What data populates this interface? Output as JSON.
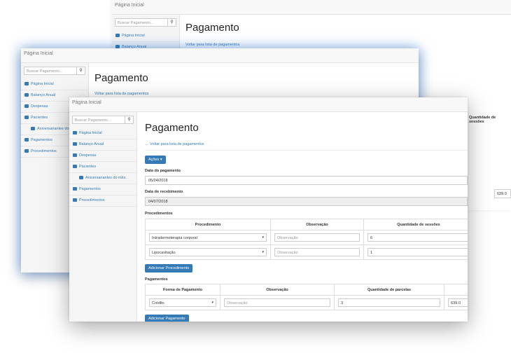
{
  "brand": "Página Inicial",
  "search": {
    "placeholder": "Buscar Pagamento...",
    "icon": "search-icon"
  },
  "sidebar": {
    "items": [
      {
        "label": "Página Inicial",
        "icon": "home-icon"
      },
      {
        "label": "Balanço Anual",
        "icon": "list-icon"
      },
      {
        "label": "Despesas",
        "icon": "list-icon"
      },
      {
        "label": "Pacientes",
        "icon": "list-icon"
      },
      {
        "label": "Aniversariantes do mês",
        "icon": "calendar-icon"
      },
      {
        "label": "Pagamentos",
        "icon": "list-icon"
      },
      {
        "label": "Procedimentos",
        "icon": "list-icon"
      }
    ]
  },
  "page": {
    "title": "Pagamento",
    "back_link": "Voltar para lista de pagamentos",
    "actions_label": "Ações ▾"
  },
  "form": {
    "data_pagamento_label": "Data do pagamento",
    "data_pagamento_value": "05/04/2018",
    "data_recebimento_label": "Data do recebimento",
    "data_recebimento_value": "04/07/2018"
  },
  "procedimentos": {
    "label": "Procedimentos",
    "headers": [
      "Procedimento",
      "Observação",
      "Quantidade de sessões"
    ],
    "rows": [
      {
        "procedimento": "Intradermoterapia corporal",
        "observacao_placeholder": "Observação",
        "quantidade": "6"
      },
      {
        "procedimento": "Lipocavitação",
        "observacao_placeholder": "Observação",
        "quantidade": "1"
      }
    ],
    "add_label": "Adicionar Procedimento"
  },
  "pagamentos": {
    "label": "Pagamentos",
    "headers": [
      "Forma de Pagamento",
      "Observação",
      "Quantidade de parcelas"
    ],
    "rows": [
      {
        "forma": "Crédito",
        "observacao_placeholder": "Observação",
        "parcelas": "3",
        "valor": "639.0"
      }
    ],
    "add_label": "Adicionar Pagamento"
  },
  "background_fragments": {
    "sessoes_header": "Quantidade de sessões",
    "valor": "639.0"
  },
  "colors": {
    "accent": "#337ab7",
    "sidebar_bg": "#f5f5f5",
    "glow": "#1e6edc"
  }
}
